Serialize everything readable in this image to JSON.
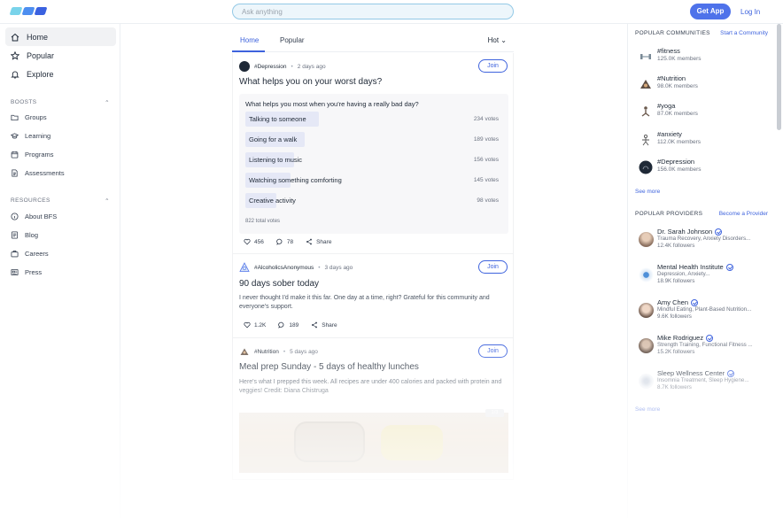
{
  "header": {
    "search_placeholder": "Ask anything",
    "get_app_label": "Get App",
    "login_label": "Log In"
  },
  "nav": {
    "main": [
      {
        "label": "Home",
        "icon": "home-icon",
        "active": true
      },
      {
        "label": "Popular",
        "icon": "star-icon",
        "active": false
      },
      {
        "label": "Explore",
        "icon": "bell-icon",
        "active": false
      }
    ],
    "boosts_title": "BOOSTS",
    "boosts": [
      {
        "label": "Groups",
        "icon": "groups-icon"
      },
      {
        "label": "Learning",
        "icon": "graduation-cap-icon"
      },
      {
        "label": "Programs",
        "icon": "calendar-icon"
      },
      {
        "label": "Assessments",
        "icon": "document-icon"
      }
    ],
    "resources_title": "RESOURCES",
    "resources": [
      {
        "label": "About BFS",
        "icon": "info-icon"
      },
      {
        "label": "Blog",
        "icon": "blog-icon"
      },
      {
        "label": "Careers",
        "icon": "briefcase-icon"
      },
      {
        "label": "Press",
        "icon": "newspaper-icon"
      }
    ]
  },
  "feed": {
    "tabs": [
      "Home",
      "Popular"
    ],
    "sort_label": "Hot",
    "posts": [
      {
        "community": "#Depression",
        "time": "2 days ago",
        "join_label": "Join",
        "title": "What helps you on your worst days?",
        "poll": {
          "question": "What helps you most when you're having a really bad day?",
          "options": [
            {
              "label": "Talking to someone",
              "votes_text": "234 votes",
              "votes": 234
            },
            {
              "label": "Going for a walk",
              "votes_text": "189 votes",
              "votes": 189
            },
            {
              "label": "Listening to music",
              "votes_text": "156 votes",
              "votes": 156
            },
            {
              "label": "Watching something comforting",
              "votes_text": "145 votes",
              "votes": 145
            },
            {
              "label": "Creative activity",
              "votes_text": "98 votes",
              "votes": 98
            }
          ],
          "total": "822 total votes"
        },
        "likes": "456",
        "comments": "78",
        "share_label": "Share"
      },
      {
        "community": "#AlcoholicsAnonymous",
        "time": "3 days ago",
        "join_label": "Join",
        "title": "90 days sober today",
        "body": "I never thought I'd make it this far. One day at a time, right? Grateful for this community and everyone's support.",
        "likes": "1.2K",
        "comments": "189",
        "share_label": "Share"
      },
      {
        "community": "#Nutrition",
        "time": "5 days ago",
        "join_label": "Join",
        "title": "Meal prep Sunday - 5 days of healthy lunches",
        "body": "Here's what I prepped this week. All recipes are under 400 calories and packed with protein and veggies! Credit: Diana Chistruga",
        "media_counter": "1/3"
      }
    ]
  },
  "sidebar": {
    "communities_title": "POPULAR COMMUNITIES",
    "start_community_label": "Start a Community",
    "communities": [
      {
        "name": "#fitness",
        "members": "125.0K members",
        "icon": "dumbbell-icon"
      },
      {
        "name": "#Nutrition",
        "members": "98.0K members",
        "icon": "food-icon"
      },
      {
        "name": "#yoga",
        "members": "87.0K members",
        "icon": "yoga-icon"
      },
      {
        "name": "#anxiety",
        "members": "112.0K members",
        "icon": "anxiety-icon"
      },
      {
        "name": "#Depression",
        "members": "156.0K members",
        "icon": "depression-icon"
      }
    ],
    "see_more_label": "See more",
    "providers_title": "POPULAR PROVIDERS",
    "become_provider_label": "Become a Provider",
    "providers": [
      {
        "name": "Dr. Sarah Johnson",
        "specialties": "Trauma Recovery, Anxiety Disorders...",
        "followers": "12.4K followers"
      },
      {
        "name": "Mental Health Institute",
        "specialties": "Depression, Anxiety...",
        "followers": "18.9K followers"
      },
      {
        "name": "Amy Chen",
        "specialties": "Mindful Eating, Plant-Based Nutrition...",
        "followers": "9.6K followers"
      },
      {
        "name": "Mike Rodriguez",
        "specialties": "Strength Training, Functional Fitness ...",
        "followers": "15.2K followers"
      },
      {
        "name": "Sleep Wellness Center",
        "specialties": "Insomnia Treatment, Sleep Hygiene...",
        "followers": "8.7K followers"
      }
    ],
    "providers_see_more_label": "See more"
  },
  "colors": {
    "accent": "#3e63dd",
    "get_app_bg": "#4e72ea",
    "search_border": "#93c9e6",
    "poll_bar": "#e5e8f6"
  }
}
